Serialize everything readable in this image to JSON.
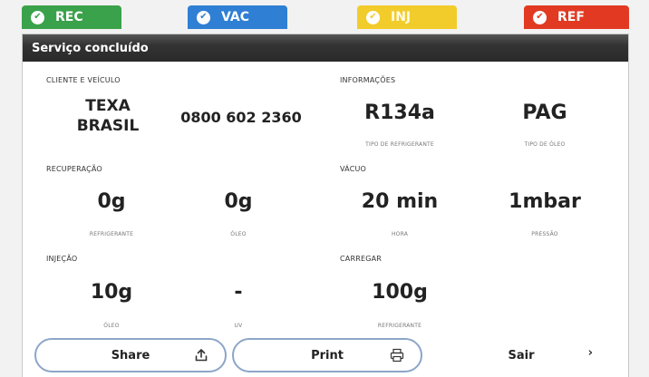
{
  "tabs": [
    {
      "label": "REC",
      "color": "#3aa24a"
    },
    {
      "label": "VAC",
      "color": "#2f7fd4"
    },
    {
      "label": "INJ",
      "color": "#f2cc2a"
    },
    {
      "label": "REF",
      "color": "#e23a22"
    }
  ],
  "panel": {
    "title": "Serviço concluído"
  },
  "client": {
    "label": "CLIENTE E VEÍCULO",
    "name_line1": "TEXA",
    "name_line2": "BRASIL",
    "phone": "0800 602 2360"
  },
  "info": {
    "label": "INFORMAÇÕES",
    "refrigerant": "R134a",
    "refrigerant_caption": "TIPO DE REFRIGERANTE",
    "oil": "PAG",
    "oil_caption": "TIPO DE ÓLEO"
  },
  "recovery": {
    "label": "RECUPERAÇÃO",
    "refrigerant": "0g",
    "refrigerant_caption": "REFRIGERANTE",
    "oil": "0g",
    "oil_caption": "ÓLEO"
  },
  "vacuum": {
    "label": "VÁCUO",
    "time": "20 min",
    "time_caption": "HORA",
    "pressure": "1mbar",
    "pressure_caption": "PRESSÃO"
  },
  "injection": {
    "label": "INJEÇÃO",
    "oil": "10g",
    "oil_caption": "ÓLEO",
    "uv": "-",
    "uv_caption": "UV"
  },
  "charge": {
    "label": "CARREGAR",
    "refrigerant": "100g",
    "refrigerant_caption": "REFRIGERANTE"
  },
  "buttons": {
    "share": "Share",
    "print": "Print",
    "exit": "Sair"
  },
  "icons": {
    "check": "check-icon",
    "share": "upload-icon",
    "print": "printer-icon",
    "exit": "chevron-right-icon"
  }
}
